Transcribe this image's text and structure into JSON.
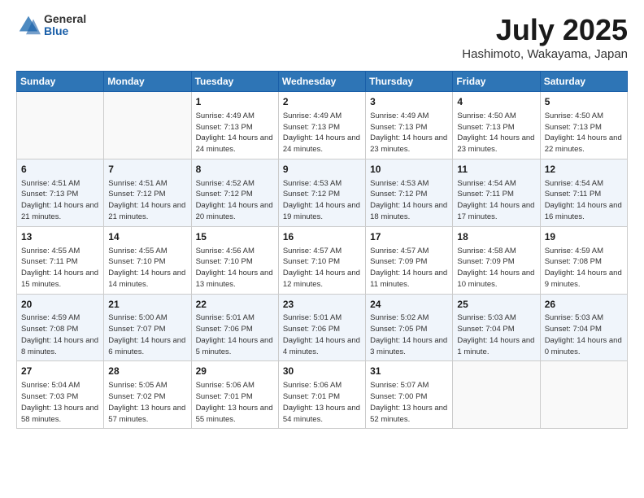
{
  "header": {
    "logo": {
      "general": "General",
      "blue": "Blue"
    },
    "title": "July 2025",
    "subtitle": "Hashimoto, Wakayama, Japan"
  },
  "days_of_week": [
    "Sunday",
    "Monday",
    "Tuesday",
    "Wednesday",
    "Thursday",
    "Friday",
    "Saturday"
  ],
  "weeks": [
    [
      {
        "day": "",
        "info": ""
      },
      {
        "day": "",
        "info": ""
      },
      {
        "day": "1",
        "info": "Sunrise: 4:49 AM\nSunset: 7:13 PM\nDaylight: 14 hours and 24 minutes."
      },
      {
        "day": "2",
        "info": "Sunrise: 4:49 AM\nSunset: 7:13 PM\nDaylight: 14 hours and 24 minutes."
      },
      {
        "day": "3",
        "info": "Sunrise: 4:49 AM\nSunset: 7:13 PM\nDaylight: 14 hours and 23 minutes."
      },
      {
        "day": "4",
        "info": "Sunrise: 4:50 AM\nSunset: 7:13 PM\nDaylight: 14 hours and 23 minutes."
      },
      {
        "day": "5",
        "info": "Sunrise: 4:50 AM\nSunset: 7:13 PM\nDaylight: 14 hours and 22 minutes."
      }
    ],
    [
      {
        "day": "6",
        "info": "Sunrise: 4:51 AM\nSunset: 7:13 PM\nDaylight: 14 hours and 21 minutes."
      },
      {
        "day": "7",
        "info": "Sunrise: 4:51 AM\nSunset: 7:12 PM\nDaylight: 14 hours and 21 minutes."
      },
      {
        "day": "8",
        "info": "Sunrise: 4:52 AM\nSunset: 7:12 PM\nDaylight: 14 hours and 20 minutes."
      },
      {
        "day": "9",
        "info": "Sunrise: 4:53 AM\nSunset: 7:12 PM\nDaylight: 14 hours and 19 minutes."
      },
      {
        "day": "10",
        "info": "Sunrise: 4:53 AM\nSunset: 7:12 PM\nDaylight: 14 hours and 18 minutes."
      },
      {
        "day": "11",
        "info": "Sunrise: 4:54 AM\nSunset: 7:11 PM\nDaylight: 14 hours and 17 minutes."
      },
      {
        "day": "12",
        "info": "Sunrise: 4:54 AM\nSunset: 7:11 PM\nDaylight: 14 hours and 16 minutes."
      }
    ],
    [
      {
        "day": "13",
        "info": "Sunrise: 4:55 AM\nSunset: 7:11 PM\nDaylight: 14 hours and 15 minutes."
      },
      {
        "day": "14",
        "info": "Sunrise: 4:55 AM\nSunset: 7:10 PM\nDaylight: 14 hours and 14 minutes."
      },
      {
        "day": "15",
        "info": "Sunrise: 4:56 AM\nSunset: 7:10 PM\nDaylight: 14 hours and 13 minutes."
      },
      {
        "day": "16",
        "info": "Sunrise: 4:57 AM\nSunset: 7:10 PM\nDaylight: 14 hours and 12 minutes."
      },
      {
        "day": "17",
        "info": "Sunrise: 4:57 AM\nSunset: 7:09 PM\nDaylight: 14 hours and 11 minutes."
      },
      {
        "day": "18",
        "info": "Sunrise: 4:58 AM\nSunset: 7:09 PM\nDaylight: 14 hours and 10 minutes."
      },
      {
        "day": "19",
        "info": "Sunrise: 4:59 AM\nSunset: 7:08 PM\nDaylight: 14 hours and 9 minutes."
      }
    ],
    [
      {
        "day": "20",
        "info": "Sunrise: 4:59 AM\nSunset: 7:08 PM\nDaylight: 14 hours and 8 minutes."
      },
      {
        "day": "21",
        "info": "Sunrise: 5:00 AM\nSunset: 7:07 PM\nDaylight: 14 hours and 6 minutes."
      },
      {
        "day": "22",
        "info": "Sunrise: 5:01 AM\nSunset: 7:06 PM\nDaylight: 14 hours and 5 minutes."
      },
      {
        "day": "23",
        "info": "Sunrise: 5:01 AM\nSunset: 7:06 PM\nDaylight: 14 hours and 4 minutes."
      },
      {
        "day": "24",
        "info": "Sunrise: 5:02 AM\nSunset: 7:05 PM\nDaylight: 14 hours and 3 minutes."
      },
      {
        "day": "25",
        "info": "Sunrise: 5:03 AM\nSunset: 7:04 PM\nDaylight: 14 hours and 1 minute."
      },
      {
        "day": "26",
        "info": "Sunrise: 5:03 AM\nSunset: 7:04 PM\nDaylight: 14 hours and 0 minutes."
      }
    ],
    [
      {
        "day": "27",
        "info": "Sunrise: 5:04 AM\nSunset: 7:03 PM\nDaylight: 13 hours and 58 minutes."
      },
      {
        "day": "28",
        "info": "Sunrise: 5:05 AM\nSunset: 7:02 PM\nDaylight: 13 hours and 57 minutes."
      },
      {
        "day": "29",
        "info": "Sunrise: 5:06 AM\nSunset: 7:01 PM\nDaylight: 13 hours and 55 minutes."
      },
      {
        "day": "30",
        "info": "Sunrise: 5:06 AM\nSunset: 7:01 PM\nDaylight: 13 hours and 54 minutes."
      },
      {
        "day": "31",
        "info": "Sunrise: 5:07 AM\nSunset: 7:00 PM\nDaylight: 13 hours and 52 minutes."
      },
      {
        "day": "",
        "info": ""
      },
      {
        "day": "",
        "info": ""
      }
    ]
  ]
}
